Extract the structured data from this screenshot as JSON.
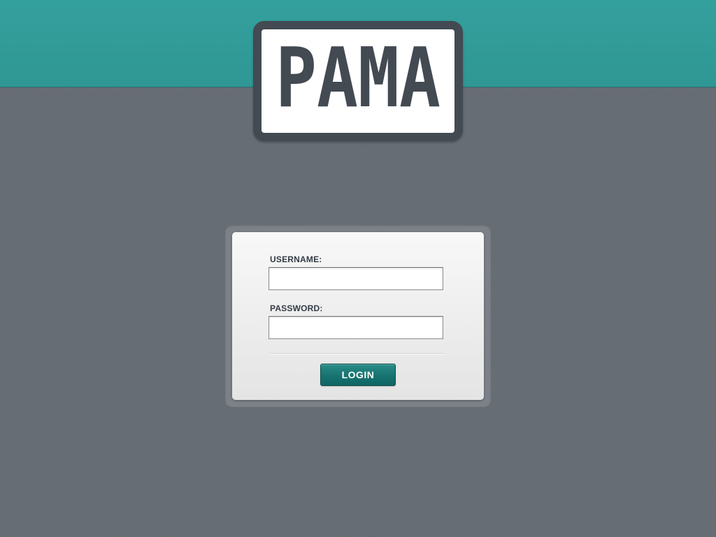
{
  "header": {
    "logo_text": "PAMA",
    "bar_color": "#319b98"
  },
  "login_form": {
    "username_label": "USERNAME:",
    "username_value": "",
    "password_label": "PASSWORD:",
    "password_value": "",
    "login_button_label": "LOGIN"
  },
  "colors": {
    "background": "#676d74",
    "accent": "#177370",
    "logo_dark": "#434a52"
  }
}
